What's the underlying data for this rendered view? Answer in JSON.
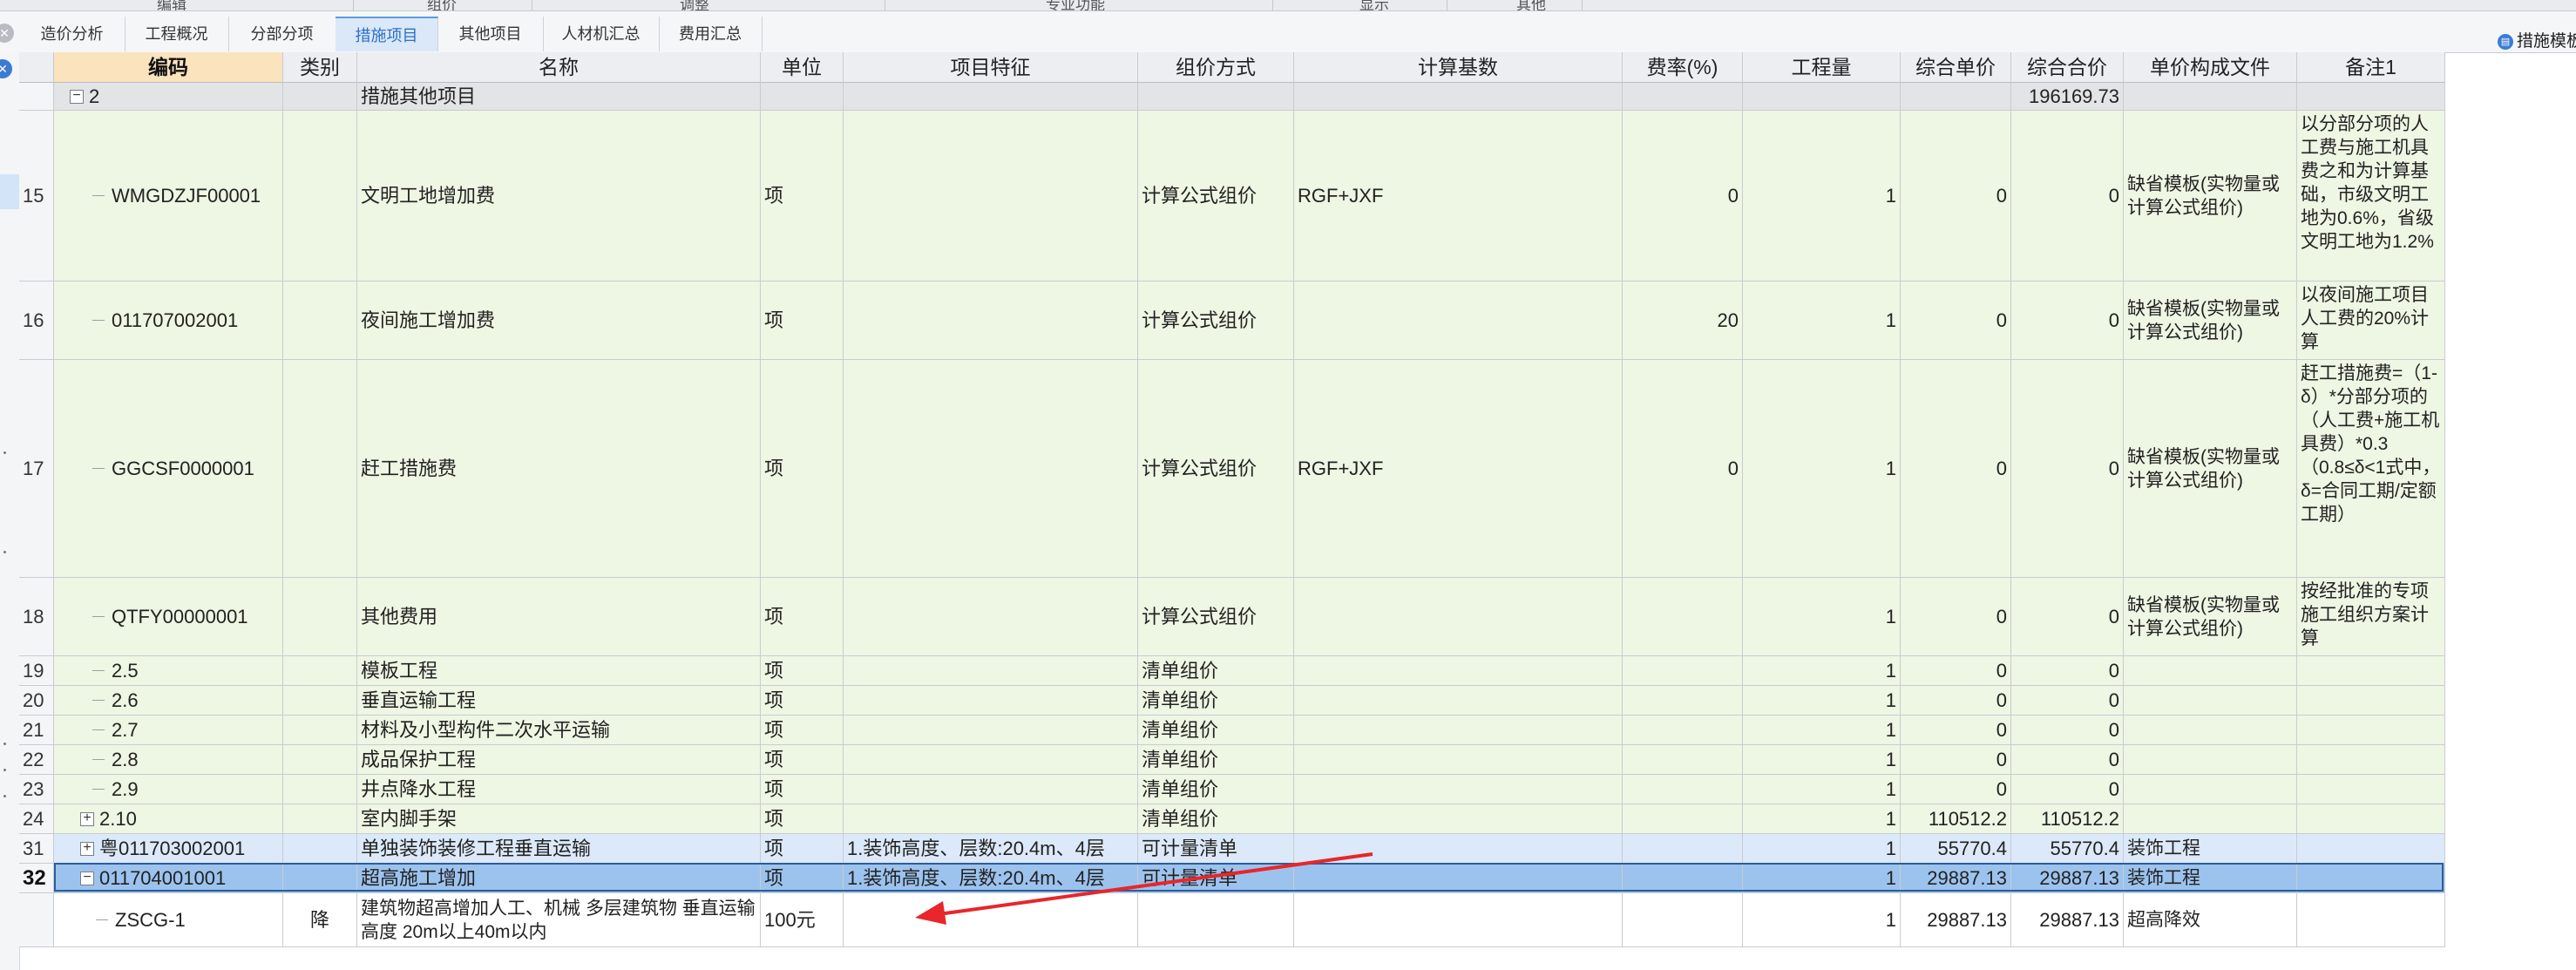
{
  "top_menu": [
    "编辑",
    "组价",
    "调整",
    "专业功能",
    "显示",
    "其他"
  ],
  "tabs": [
    {
      "label": "造价分析",
      "active": false
    },
    {
      "label": "工程概况",
      "active": false
    },
    {
      "label": "分部分项",
      "active": false
    },
    {
      "label": "措施项目",
      "active": true
    },
    {
      "label": "其他项目",
      "active": false
    },
    {
      "label": "人材机汇总",
      "active": false
    },
    {
      "label": "费用汇总",
      "active": false
    }
  ],
  "right_button": {
    "label": "措施模板"
  },
  "columns": [
    "编码",
    "类别",
    "名称",
    "单位",
    "项目特征",
    "组价方式",
    "计算基数",
    "费率(%)",
    "工程量",
    "综合单价",
    "综合合价",
    "单价构成文件",
    "备注1"
  ],
  "colors": {
    "row_green": "#eef6e4",
    "row_group": "#e3e4e6",
    "row_blue_light": "#dce9f8",
    "row_selected": "#9cc3ee",
    "row_white": "#ffffff",
    "arrow": "#e8262b"
  },
  "rows": [
    {
      "num": "",
      "code": "2",
      "expander": "minus",
      "name": "措施其他项目",
      "total": "196169.73",
      "style": "group"
    },
    {
      "num": "15",
      "code": "WMGDZJF00001",
      "name": "文明工地增加费",
      "unit": "项",
      "method": "计算公式组价",
      "base": "RGF+JXF",
      "rate": "0",
      "qty": "1",
      "price": "0",
      "total": "0",
      "template": "缺省模板(实物量或计算公式组价)",
      "remark": "以分部分项的人工费与施工机具费之和为计算基础，市级文明工地为0.6%，省级文明工地为1.2%",
      "style": "green"
    },
    {
      "num": "16",
      "code": "011707002001",
      "name": "夜间施工增加费",
      "unit": "项",
      "method": "计算公式组价",
      "base": "",
      "rate": "20",
      "qty": "1",
      "price": "0",
      "total": "0",
      "template": "缺省模板(实物量或计算公式组价)",
      "remark": "以夜间施工项目人工费的20%计算",
      "style": "green"
    },
    {
      "num": "17",
      "code": "GGCSF0000001",
      "name": "赶工措施费",
      "unit": "项",
      "method": "计算公式组价",
      "base": "RGF+JXF",
      "rate": "0",
      "qty": "1",
      "price": "0",
      "total": "0",
      "template": "缺省模板(实物量或计算公式组价)",
      "remark": "赶工措施费=（1-δ）*分部分项的（人工费+施工机具费）*0.3（0.8≤δ<1式中，δ=合同工期/定额工期）",
      "style": "green"
    },
    {
      "num": "18",
      "code": "QTFY00000001",
      "name": "其他费用",
      "unit": "项",
      "method": "计算公式组价",
      "base": "",
      "rate": "",
      "qty": "1",
      "price": "0",
      "total": "0",
      "template": "缺省模板(实物量或计算公式组价)",
      "remark": "按经批准的专项施工组织方案计算",
      "style": "green"
    },
    {
      "num": "19",
      "code": "2.5",
      "name": "模板工程",
      "unit": "项",
      "method": "清单组价",
      "qty": "1",
      "price": "0",
      "total": "0",
      "style": "green"
    },
    {
      "num": "20",
      "code": "2.6",
      "name": "垂直运输工程",
      "unit": "项",
      "method": "清单组价",
      "qty": "1",
      "price": "0",
      "total": "0",
      "style": "green"
    },
    {
      "num": "21",
      "code": "2.7",
      "name": "材料及小型构件二次水平运输",
      "unit": "项",
      "method": "清单组价",
      "qty": "1",
      "price": "0",
      "total": "0",
      "style": "green"
    },
    {
      "num": "22",
      "code": "2.8",
      "name": "成品保护工程",
      "unit": "项",
      "method": "清单组价",
      "qty": "1",
      "price": "0",
      "total": "0",
      "style": "green"
    },
    {
      "num": "23",
      "code": "2.9",
      "name": "井点降水工程",
      "unit": "项",
      "method": "清单组价",
      "qty": "1",
      "price": "0",
      "total": "0",
      "style": "green"
    },
    {
      "num": "24",
      "code": "2.10",
      "expander": "plus",
      "name": "室内脚手架",
      "unit": "项",
      "method": "清单组价",
      "qty": "1",
      "price": "110512.2",
      "total": "110512.2",
      "style": "green"
    },
    {
      "num": "31",
      "code": "粤011703002001",
      "expander": "plus",
      "name": "单独装饰装修工程垂直运输",
      "unit": "项",
      "feature": "1.装饰高度、层数:20.4m、4层",
      "method": "可计量清单",
      "qty": "1",
      "price": "55770.4",
      "total": "55770.4",
      "template": "装饰工程",
      "style": "blue"
    },
    {
      "num": "32",
      "code": "011704001001",
      "expander": "minus",
      "name": "超高施工增加",
      "unit": "项",
      "feature": "1.装饰高度、层数:20.4m、4层",
      "method": "可计量清单",
      "qty": "1",
      "price": "29887.13",
      "total": "29887.13",
      "template": "装饰工程",
      "style": "selected"
    },
    {
      "num": "",
      "code": "ZSCG-1",
      "category": "降",
      "name": "建筑物超高增加人工、机械 多层建筑物 垂直运输高度 20m以上40m以内",
      "unit": "100元",
      "qty": "1",
      "price": "29887.13",
      "total": "29887.13",
      "template": "超高降效",
      "style": "white"
    }
  ]
}
